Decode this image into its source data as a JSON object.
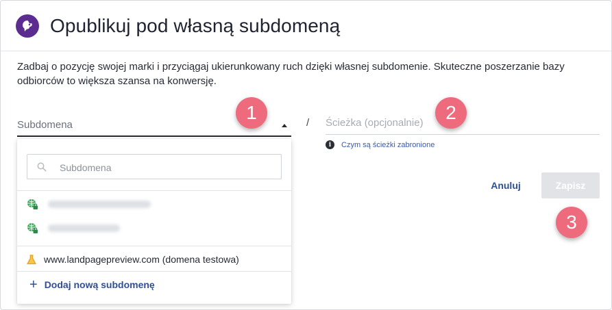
{
  "dialog": {
    "title": "Opublikuj pod własną subdomeną",
    "description": "Zadbaj o pozycję swojej marki i przyciągaj ukierunkowany ruch dzięki własnej subdomenie. Skuteczne poszerzanie bazy odbiorców to większa szansa na konwersję."
  },
  "subdomain": {
    "label": "Subdomena",
    "separator": "/",
    "dropdown": {
      "search_placeholder": "Subdomena",
      "test_domain_label": "www.landpagepreview.com (domena testowa)",
      "add_label": "Dodaj nową subdomenę"
    }
  },
  "path": {
    "label": "Ścieżka (opcjonalnie)",
    "hint": "Czym są ścieżki zabronione"
  },
  "actions": {
    "cancel": "Anuluj",
    "save": "Zapisz"
  },
  "markers": [
    "1",
    "2",
    "3"
  ],
  "colors": {
    "brand": "#5c2d91",
    "accent": "#2f4f93",
    "marker": "#ee6b7e",
    "verified": "#3aa657",
    "test": "#e8a317"
  },
  "icons": {
    "logo": "landingi-logo-icon",
    "search": "search-icon",
    "domain": "globe-lock-icon",
    "test": "flask-icon",
    "info": "info-icon",
    "add": "plus-icon"
  }
}
